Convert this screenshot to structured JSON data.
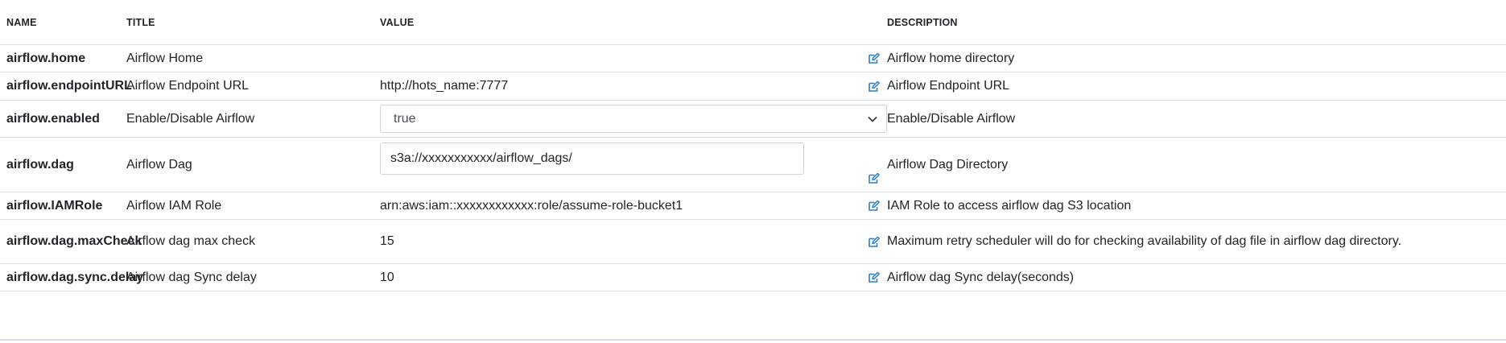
{
  "columns": {
    "name": "NAME",
    "title": "TITLE",
    "value": "VALUE",
    "description": "DESCRIPTION"
  },
  "rows": [
    {
      "name": "airflow.home",
      "title": "Airflow Home",
      "value": "",
      "value_type": "text",
      "description": "Airflow home directory"
    },
    {
      "name": "airflow.endpointURL",
      "title": "Airflow Endpoint URL",
      "value": "http://hots_name:7777",
      "value_type": "text",
      "description": "Airflow Endpoint URL"
    },
    {
      "name": "airflow.enabled",
      "title": "Enable/Disable Airflow",
      "value": "true",
      "value_type": "select",
      "description": "Enable/Disable Airflow"
    },
    {
      "name": "airflow.dag",
      "title": "Airflow Dag",
      "value": "s3a://xxxxxxxxxxx/airflow_dags/",
      "value_type": "input",
      "description": "Airflow Dag Directory"
    },
    {
      "name": "airflow.IAMRole",
      "title": "Airflow IAM Role",
      "value": "arn:aws:iam::xxxxxxxxxxxx:role/assume-role-bucket1",
      "value_type": "text",
      "description": "IAM Role to access airflow dag S3 location"
    },
    {
      "name": "airflow.dag.maxCheck",
      "title": "Airflow dag max check",
      "value": "15",
      "value_type": "text",
      "description": "Maximum retry scheduler will do for checking availability of dag file in airflow dag directory."
    },
    {
      "name": "airflow.dag.sync.delay",
      "title": "Airflow dag Sync delay",
      "value": "10",
      "value_type": "text",
      "description": "Airflow dag Sync delay(seconds)"
    }
  ],
  "icons": {
    "edit": "edit-icon",
    "dropdown": "chevron-down-icon"
  },
  "colors": {
    "accent": "#2f7fc1",
    "border": "#dee2e6",
    "text": "#212529"
  }
}
